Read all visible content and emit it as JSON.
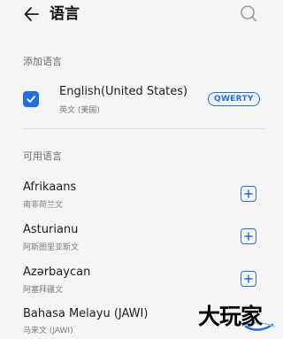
{
  "header": {
    "title": "语言",
    "back_icon": "arrow-left-icon",
    "search_icon": "search-icon"
  },
  "sections": {
    "added_label": "添加语言",
    "available_label": "可用语言"
  },
  "added_languages": [
    {
      "name": "English(United States)",
      "native": "英文 (美国)",
      "keyboard": "QWERTY",
      "checked": true
    }
  ],
  "available_languages": [
    {
      "name": "Afrikaans",
      "native": "南非荷兰文"
    },
    {
      "name": "Asturianu",
      "native": "阿斯图里亚斯文"
    },
    {
      "name": "Azərbaycan",
      "native": "阿塞拜疆文"
    },
    {
      "name": "Bahasa Melayu (JAWI)",
      "native": "马来文 (JAWI)"
    }
  ],
  "watermark": {
    "text": "大玩家"
  },
  "colors": {
    "accent": "#1f6fe0",
    "background": "#f5f5f5"
  }
}
